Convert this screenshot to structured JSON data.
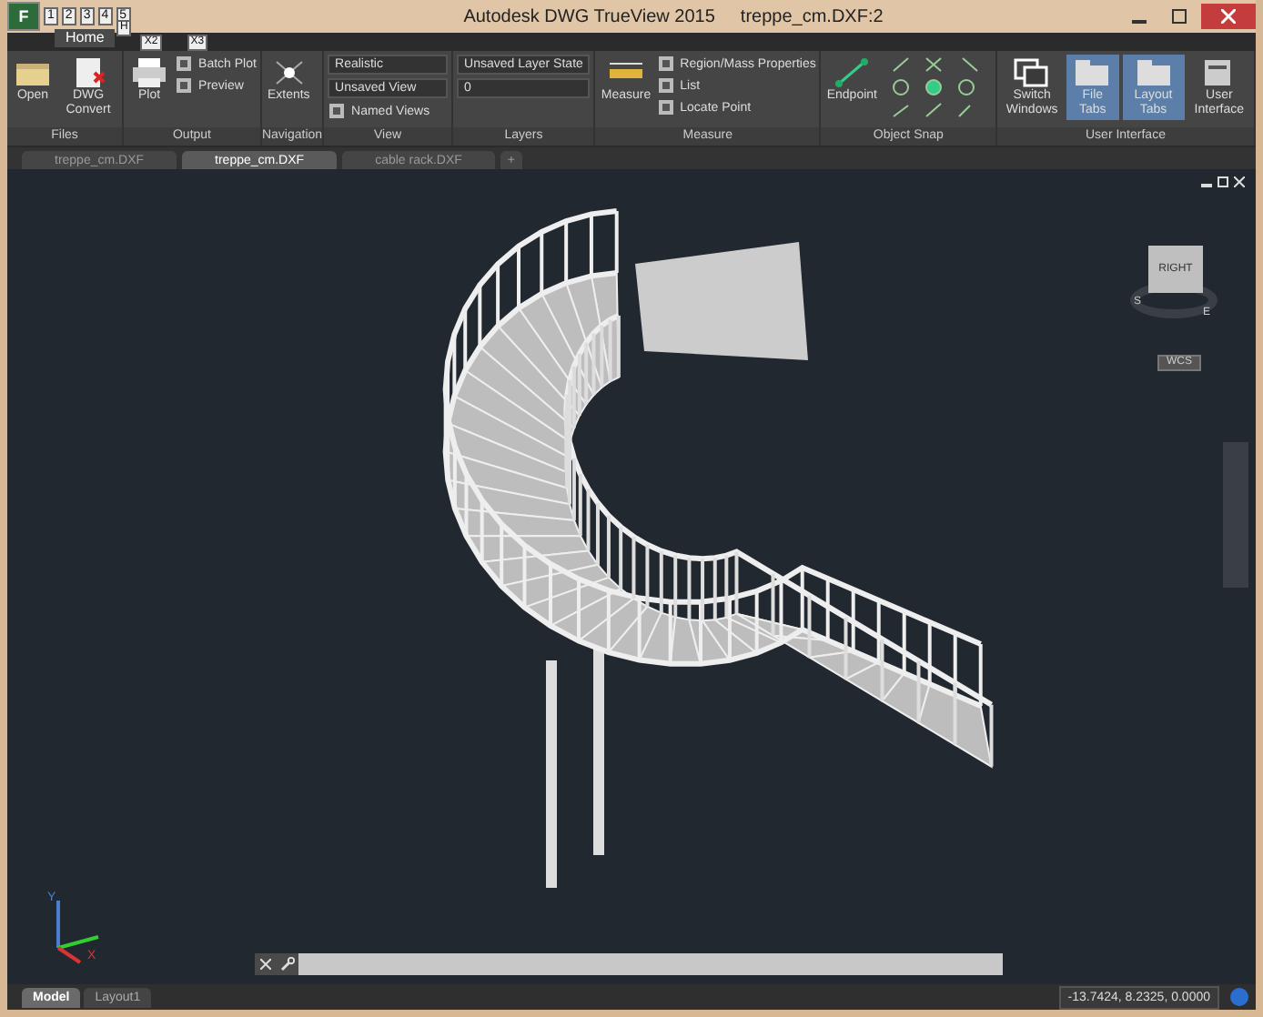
{
  "window": {
    "title": "Autodesk DWG TrueView 2015",
    "document": "treppe_cm.DXF:2"
  },
  "app_button": {
    "label": "F"
  },
  "keytips": [
    "1",
    "2",
    "3",
    "4",
    "5"
  ],
  "ribbon_tabs": [
    {
      "label": "Home",
      "selected": true,
      "keytip": "H"
    }
  ],
  "ribbon_keytips": [
    "X2",
    "X3"
  ],
  "panels": [
    {
      "title": "Files",
      "large": [
        {
          "label": "Open"
        },
        {
          "label": "DWG Convert"
        }
      ]
    },
    {
      "title": "Output",
      "large": [
        {
          "label": "Plot"
        }
      ],
      "small": [
        "Batch Plot",
        "Preview"
      ]
    },
    {
      "title": "Navigation",
      "large": [
        {
          "label": "Extents"
        }
      ]
    },
    {
      "title": "View",
      "dropdowns": [
        "Realistic",
        "Unsaved View"
      ],
      "small": [
        "Named Views"
      ]
    },
    {
      "title": "Layers",
      "dropdowns": [
        "Unsaved Layer State",
        "0"
      ]
    },
    {
      "title": "Measure",
      "large": [
        {
          "label": "Measure"
        }
      ],
      "small": [
        "Region/Mass Properties",
        "List",
        "Locate Point"
      ]
    },
    {
      "title": "Object Snap",
      "large": [
        {
          "label": "Endpoint"
        }
      ]
    },
    {
      "title": "User Interface",
      "large": [
        {
          "label": "Switch Windows",
          "selected": false
        },
        {
          "label": "File Tabs",
          "selected": true
        },
        {
          "label": "Layout Tabs",
          "selected": true
        },
        {
          "label": "User Interface",
          "selected": false
        }
      ]
    }
  ],
  "file_tabs": [
    {
      "label": "treppe_cm.DXF",
      "selected": false
    },
    {
      "label": "treppe_cm.DXF",
      "selected": true
    },
    {
      "label": "cable rack.DXF",
      "selected": false
    },
    {
      "label": "+",
      "selected": false
    }
  ],
  "viewcube": {
    "face": "RIGHT",
    "compass": [
      "S",
      "E"
    ],
    "ucs": "WCS"
  },
  "axes": {
    "y": "Y",
    "x": "X"
  },
  "layout_tabs": [
    {
      "label": "Model",
      "selected": true
    },
    {
      "label": "Layout1",
      "selected": false
    }
  ],
  "coordinates": "-13.7424, 8.2325, 0.0000"
}
